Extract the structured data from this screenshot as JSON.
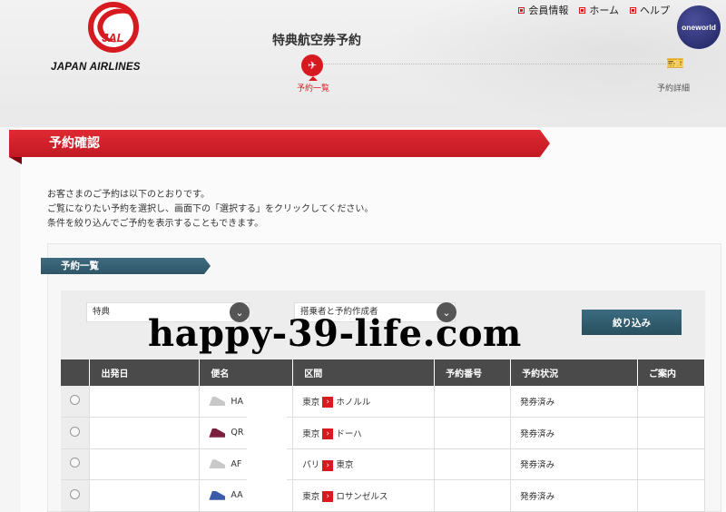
{
  "brand": {
    "logo_text": "JAL",
    "name": "JAPAN AIRLINES"
  },
  "header": {
    "title": "特典航空券予約",
    "nav": [
      "会員情報",
      "ホーム",
      "ヘルプ"
    ],
    "alliance": "oneworld"
  },
  "steps": [
    {
      "label": "予約一覧",
      "active": true
    },
    {
      "label": "予約詳細",
      "active": false
    }
  ],
  "banner": "予約確認",
  "intro": [
    "お客さまのご予約は以下のとおりです。",
    "ご覧になりたい予約を選択し、画面下の「選択する」をクリックしてください。",
    "条件を絞り込んでご予約を表示することもできます。"
  ],
  "list": {
    "title": "予約一覧",
    "filter1": "特典",
    "filter2": "搭乗者と予約作成者",
    "filter_button": "絞り込み",
    "columns": [
      "",
      "出発日",
      "便名",
      "区間",
      "予約番号",
      "予約状況",
      "ご案内"
    ],
    "rows": [
      {
        "flight": "HA",
        "from": "東京",
        "to": "ホノルル",
        "status": "発券済み",
        "tail_color": "#c8c8c8"
      },
      {
        "flight": "QR",
        "from": "東京",
        "to": "ドーハ",
        "status": "発券済み",
        "tail_color": "#7a1f3d"
      },
      {
        "flight": "AF",
        "from": "パリ",
        "to": "東京",
        "status": "発券済み",
        "tail_color": "#c8c8c8"
      },
      {
        "flight": "AA",
        "from": "東京",
        "to": "ロサンゼルス",
        "status": "発券済み",
        "tail_color": "#3b5ba8"
      }
    ]
  },
  "watermark": "happy-39-life.com",
  "colors": {
    "jal_red": "#d71920",
    "teal": "#2e5668",
    "header_dark": "#4a4a4a"
  }
}
